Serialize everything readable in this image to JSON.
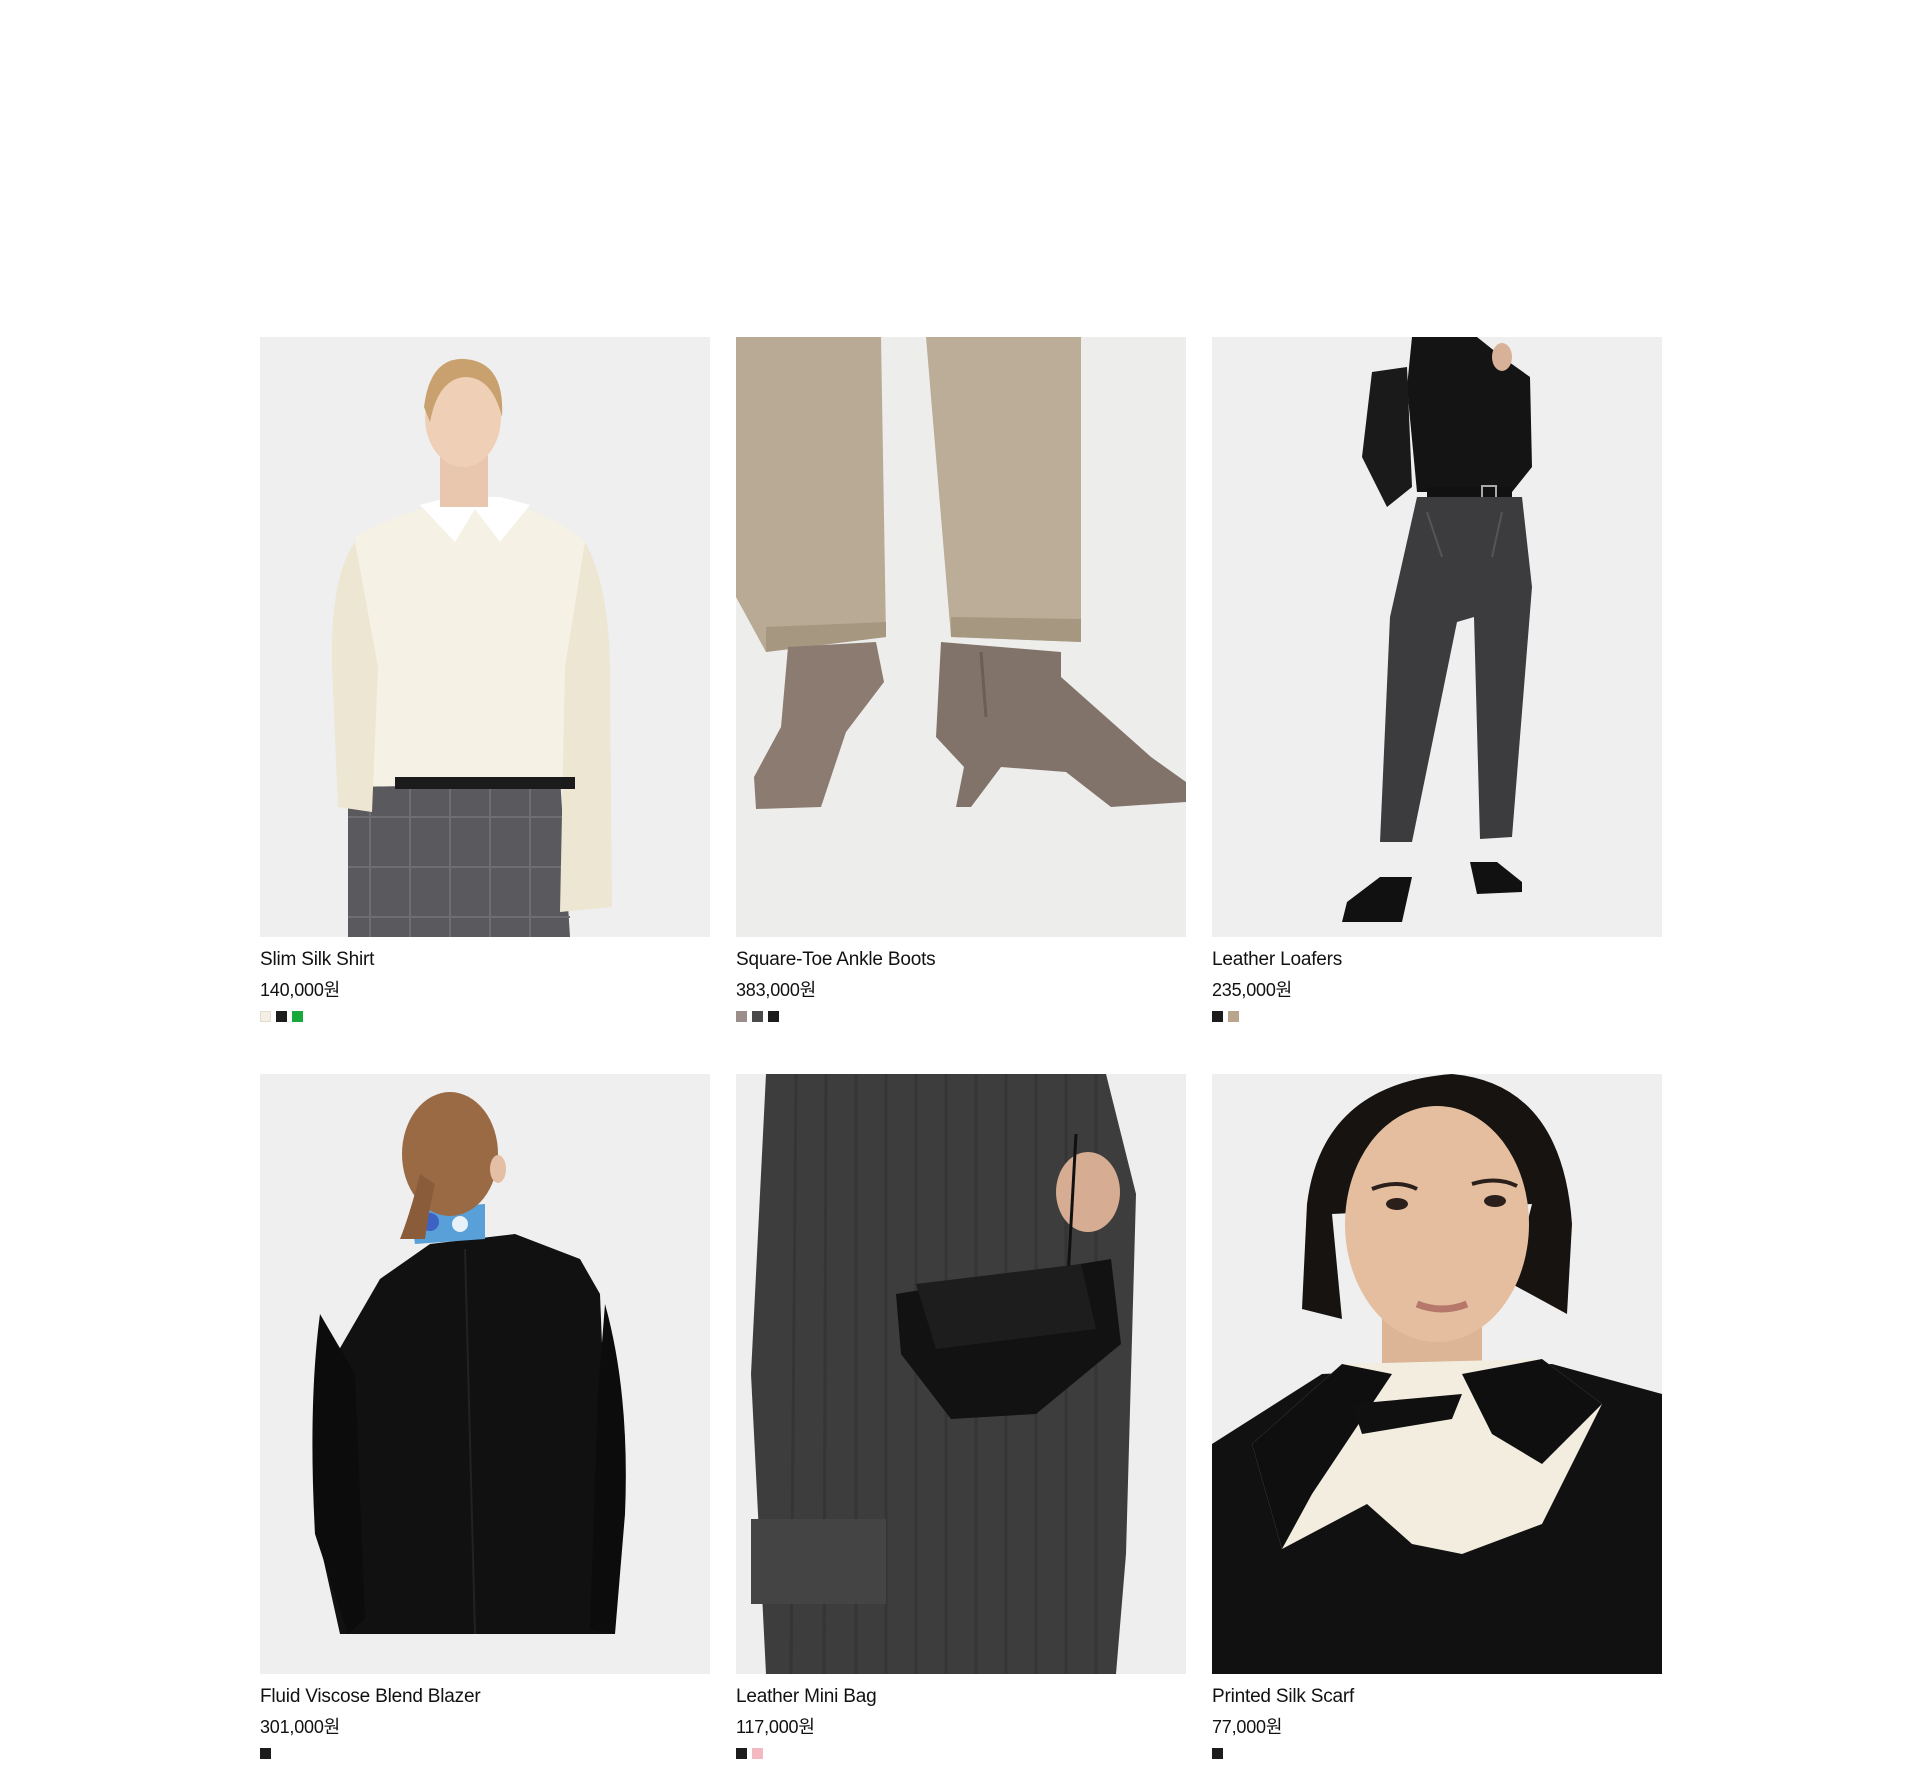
{
  "products": [
    {
      "name": "Slim Silk Shirt",
      "price": "140,000원",
      "swatches": [
        "#f3efe4",
        "#1c1c1c",
        "#17a93c"
      ]
    },
    {
      "name": "Square-Toe Ankle Boots",
      "price": "383,000원",
      "swatches": [
        "#9a8d8a",
        "#4a4a4a",
        "#1c1c1c"
      ]
    },
    {
      "name": "Leather Loafers",
      "price": "235,000원",
      "swatches": [
        "#1c1c1c",
        "#b9a48c"
      ]
    },
    {
      "name": "Fluid Viscose Blend Blazer",
      "price": "301,000원",
      "swatches": [
        "#1c1c1c"
      ]
    },
    {
      "name": "Leather Mini Bag",
      "price": "117,000원",
      "swatches": [
        "#1c1c1c",
        "#f3b8c0"
      ]
    },
    {
      "name": "Printed Silk Scarf",
      "price": "77,000원",
      "swatches": [
        "#1c1c1c"
      ]
    }
  ]
}
